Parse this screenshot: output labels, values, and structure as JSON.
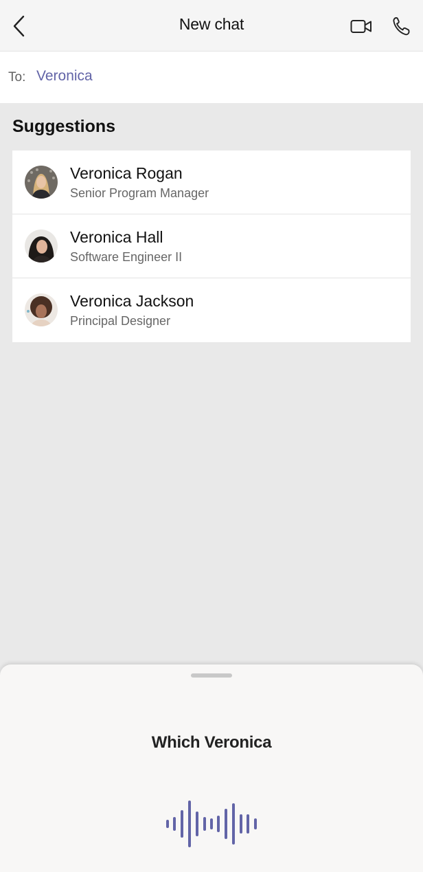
{
  "header": {
    "title": "New chat",
    "back_icon": "chevron-left-icon",
    "video_icon": "video-camera-icon",
    "call_icon": "phone-icon"
  },
  "to_field": {
    "label": "To:",
    "value": "Veronica"
  },
  "suggestions": {
    "title": "Suggestions",
    "items": [
      {
        "name": "Veronica Rogan",
        "role": "Senior Program Manager"
      },
      {
        "name": "Veronica Hall",
        "role": "Software Engineer II"
      },
      {
        "name": "Veronica Jackson",
        "role": "Principal Designer"
      }
    ]
  },
  "voice_sheet": {
    "prompt": "Which Veronica",
    "waveform_icon": "voice-waveform-icon"
  },
  "colors": {
    "accent": "#6264a7",
    "header_bg": "#f5f5f5",
    "page_bg": "#e9e9e9",
    "sheet_bg": "#f8f7f6"
  }
}
